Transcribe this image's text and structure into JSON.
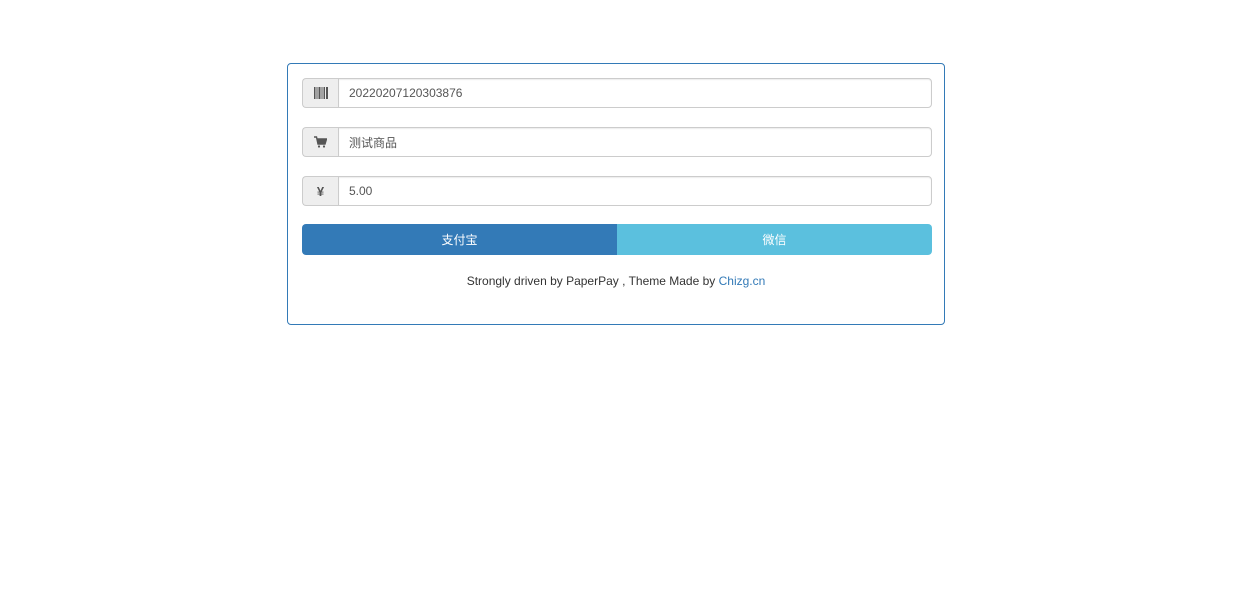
{
  "form": {
    "order_no": {
      "icon": "barcode-icon",
      "value": "20220207120303876"
    },
    "product": {
      "icon": "shopping-cart-icon",
      "value": "测试商品"
    },
    "amount": {
      "icon": "yen-icon",
      "value": "5.00"
    }
  },
  "buttons": {
    "alipay_label": "支付宝",
    "wechat_label": "微信",
    "alipay_color": "#337ab7",
    "wechat_color": "#5bc0de"
  },
  "footer": {
    "text": "Strongly driven by PaperPay , Theme Made by ",
    "link_text": "Chizg.cn"
  }
}
